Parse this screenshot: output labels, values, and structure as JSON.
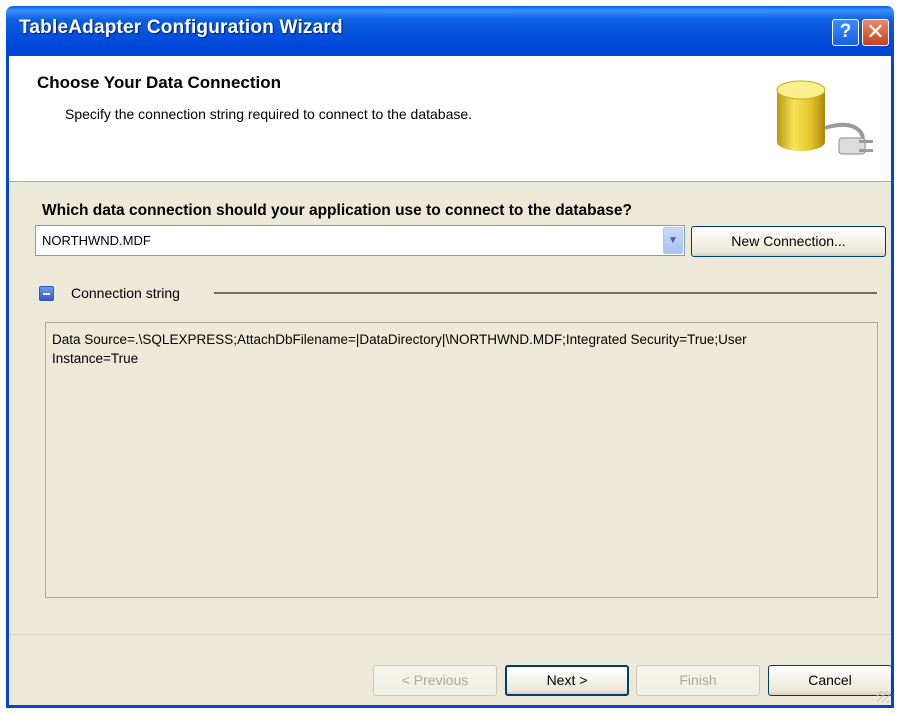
{
  "window": {
    "title": "TableAdapter Configuration Wizard",
    "help_glyph": "?",
    "close_glyph": "✕"
  },
  "header": {
    "title": "Choose Your Data Connection",
    "subtitle": "Specify the connection string required to connect to the database.",
    "icon": "database-plug-icon"
  },
  "connection": {
    "question": "Which data connection should your application use to connect to the database?",
    "selected_value": "NORTHWND.MDF",
    "new_connection_label": "New Connection...",
    "group_label": "Connection string",
    "connection_string": "Data Source=.\\SQLEXPRESS;AttachDbFilename=|DataDirectory|\\NORTHWND.MDF;Integrated Security=True;User Instance=True"
  },
  "footer": {
    "previous_label": "< Previous",
    "next_label": "Next >",
    "finish_label": "Finish",
    "cancel_label": "Cancel"
  },
  "colors": {
    "titlebar": "#0047d8",
    "dialog_bg": "#ece9d8",
    "header_bg": "#ffffff"
  }
}
